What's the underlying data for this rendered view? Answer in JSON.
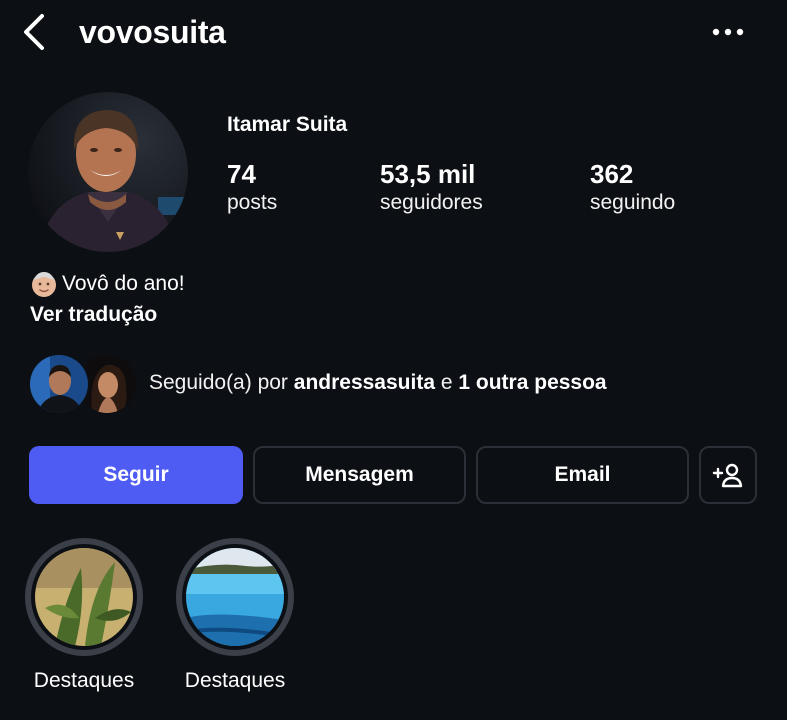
{
  "header": {
    "username": "vovosuita"
  },
  "profile": {
    "display_name": "Itamar Suita",
    "stats": {
      "posts": {
        "value": "74",
        "label": "posts"
      },
      "followers": {
        "value": "53,5 mil",
        "label": "seguidores"
      },
      "following": {
        "value": "362",
        "label": "seguindo"
      }
    },
    "bio": "Vovô do ano!",
    "translate_label": "Ver tradução"
  },
  "followed_by": {
    "prefix": "Seguido(a) por",
    "user": "andressasuita",
    "connector": "e",
    "others": "1 outra pessoa"
  },
  "actions": {
    "follow_label": "Seguir",
    "message_label": "Mensagem",
    "email_label": "Email"
  },
  "highlights": [
    {
      "label": "Destaques"
    },
    {
      "label": "Destaques"
    }
  ],
  "colors": {
    "background": "#0c0f14",
    "primary_button": "#4e5cf3",
    "button_border": "#2c2f37",
    "highlight_ring": "#3b3f47"
  },
  "icons": {
    "back": "chevron-left-icon",
    "more": "more-horizontal-icon",
    "add_user": "add-user-icon",
    "bio_emoji": "older-person-emoji-icon"
  }
}
